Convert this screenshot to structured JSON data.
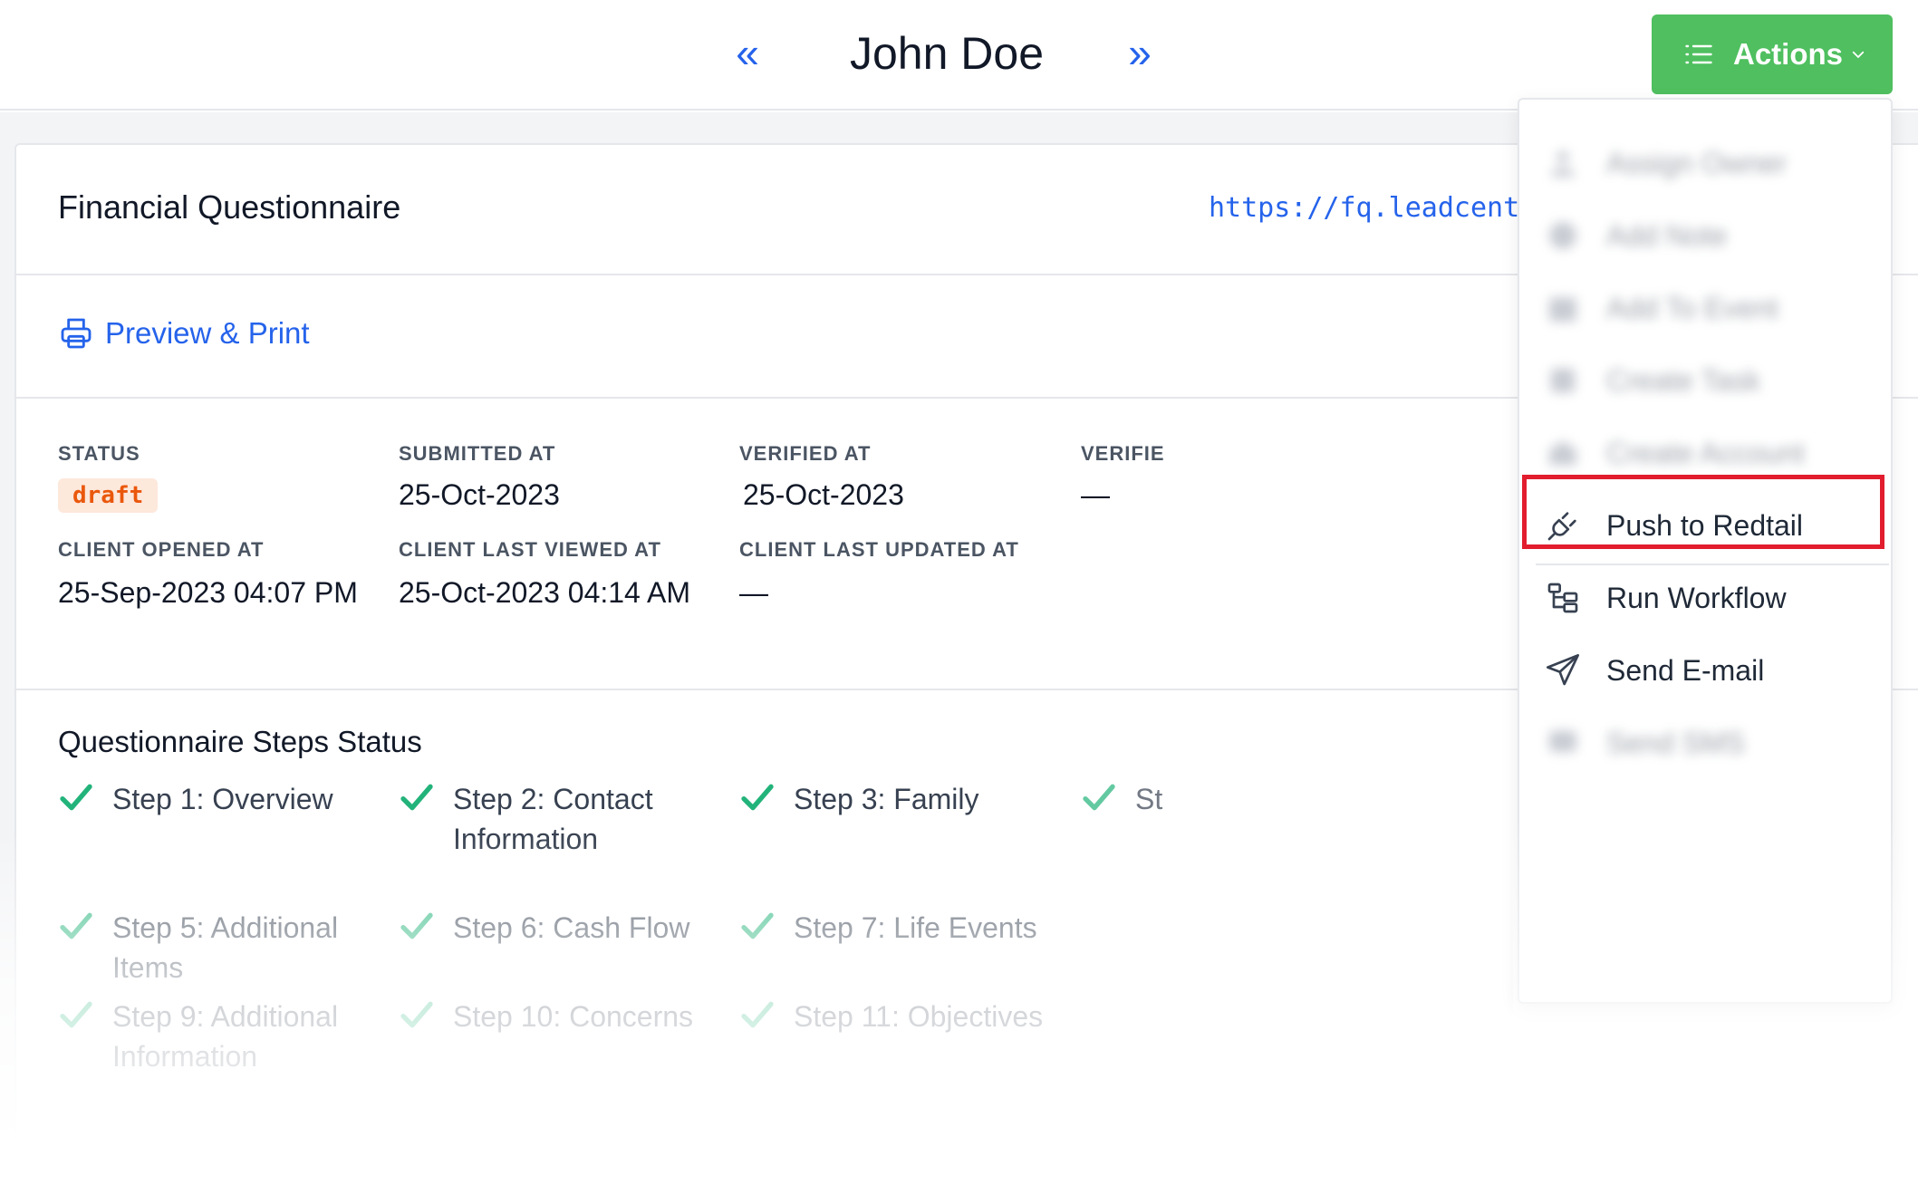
{
  "header": {
    "prev_icon": "«",
    "next_icon": "»",
    "name": "John Doe",
    "actions_label": "Actions"
  },
  "card": {
    "title": "Financial Questionnaire",
    "url": "https://fq.leadcente",
    "preview_label": "Preview & Print"
  },
  "meta": {
    "status_label": "STATUS",
    "status_value": "draft",
    "submitted_label": "SUBMITTED AT",
    "submitted_value": "25-Oct-2023",
    "verified_label": "VERIFIED AT",
    "verified_value": "25-Oct-2023",
    "verified_by_label": "VERIFIE",
    "verified_by_value": "—",
    "opened_label": "CLIENT OPENED AT",
    "opened_value": "25-Sep-2023 04:07 PM",
    "last_viewed_label": "CLIENT LAST VIEWED AT",
    "last_viewed_value": "25-Oct-2023 04:14 AM",
    "last_updated_label": "CLIENT LAST UPDATED AT",
    "last_updated_value": "—"
  },
  "steps": {
    "title": "Questionnaire Steps Status",
    "items": [
      "Step 1: Overview",
      "Step 2: Contact Information",
      "Step 3: Family",
      "St",
      "Step 5: Additional Items",
      "Step 6: Cash Flow",
      "Step 7: Life Events",
      "Step 9: Additional Information",
      "Step 10: Concerns",
      "Step 11: Objectives"
    ]
  },
  "menu": {
    "items": [
      {
        "label": "Assign Owner",
        "icon": "user-icon"
      },
      {
        "label": "Add Note",
        "icon": "note-icon"
      },
      {
        "label": "Add To Event",
        "icon": "calendar-icon"
      },
      {
        "label": "Create Task",
        "icon": "task-icon"
      },
      {
        "label": "Create Account",
        "icon": "bank-icon"
      },
      {
        "label": "Push to Redtail",
        "icon": "plug-icon"
      },
      {
        "label": "Run Workflow",
        "icon": "workflow-icon"
      },
      {
        "label": "Send E-mail",
        "icon": "send-icon"
      },
      {
        "label": "Send SMS",
        "icon": "sms-icon"
      }
    ]
  },
  "colors": {
    "accent": "#2563eb",
    "actions_bg": "#4fbf5f",
    "check": "#22b37a",
    "badge_bg": "#fde8dc",
    "badge_text": "#ea580c",
    "highlight": "#e11d2e"
  }
}
